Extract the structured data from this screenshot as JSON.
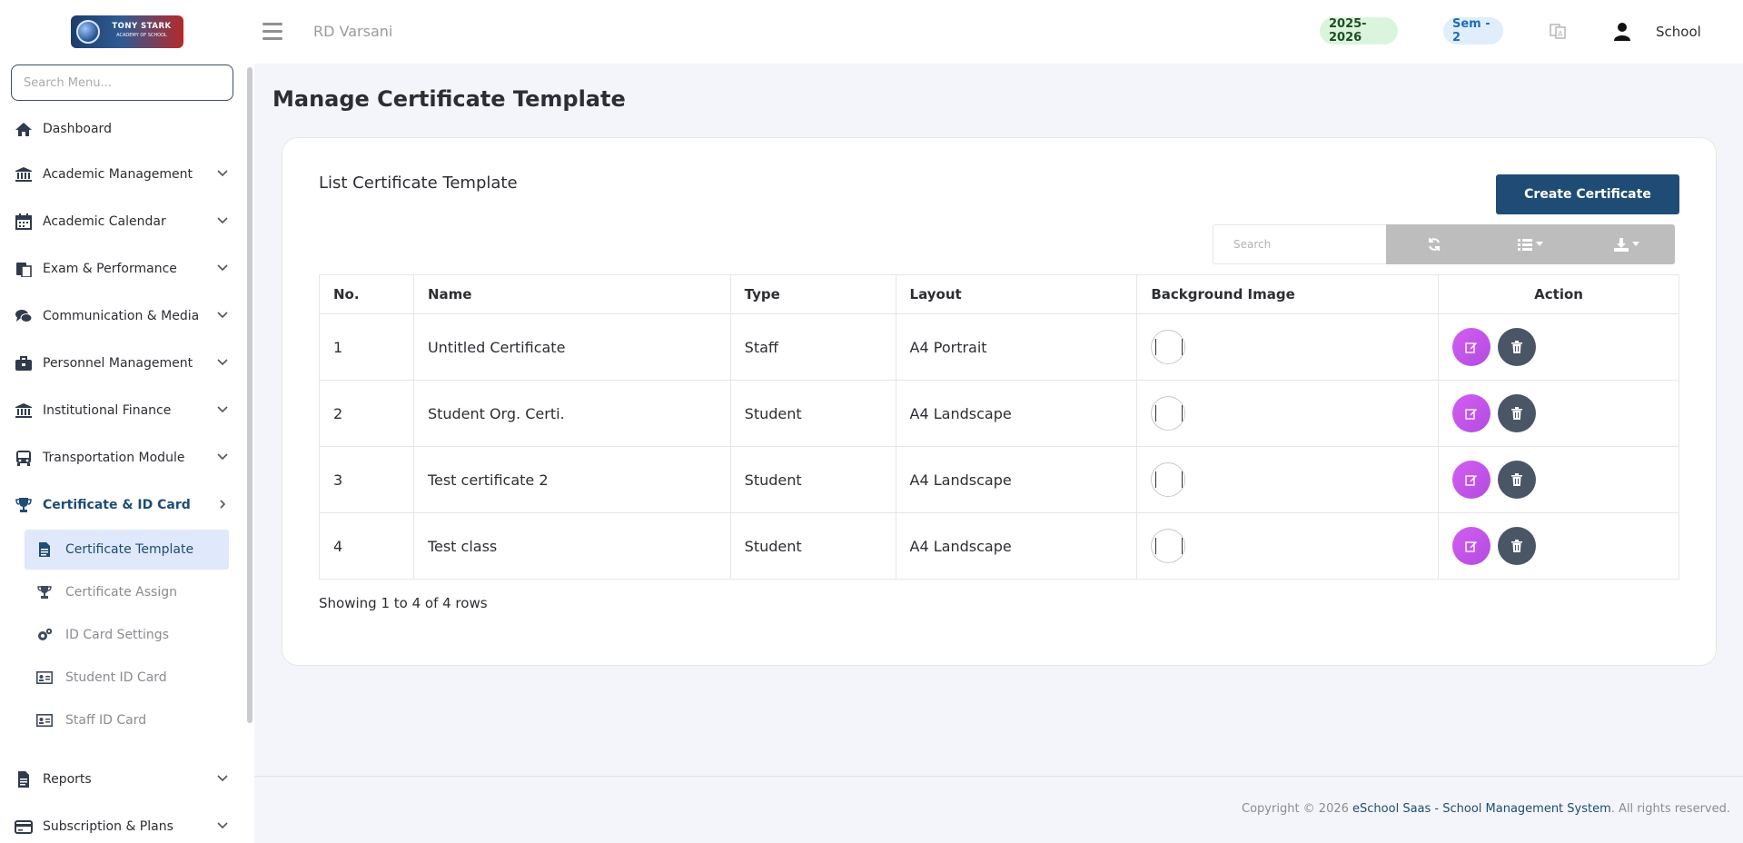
{
  "header": {
    "brand_text": "TONY STARK",
    "brand_subtext": "ACADEMY OF SCHOOL",
    "school_name": "RD Varsani",
    "session_year": "2025-2026",
    "semester": "Sem - 2",
    "user_label": "School"
  },
  "sidebar": {
    "search_placeholder": "Search Menu...",
    "items": [
      {
        "label": "Dashboard",
        "icon": "home-icon"
      },
      {
        "label": "Academic Management",
        "icon": "bank-icon"
      },
      {
        "label": "Academic Calendar",
        "icon": "calendar-icon"
      },
      {
        "label": "Exam & Performance",
        "icon": "paste-icon"
      },
      {
        "label": "Communication & Media",
        "icon": "comments-icon"
      },
      {
        "label": "Personnel Management",
        "icon": "briefcase-icon"
      },
      {
        "label": "Institutional Finance",
        "icon": "bank-icon"
      },
      {
        "label": "Transportation Module",
        "icon": "bus-icon"
      },
      {
        "label": "Certificate & ID Card",
        "icon": "trophy-icon"
      },
      {
        "label": "Reports",
        "icon": "file-icon"
      },
      {
        "label": "Subscription & Plans",
        "icon": "credit-card-icon"
      }
    ],
    "sub_items": [
      {
        "label": "Certificate Template",
        "icon": "file-text-icon"
      },
      {
        "label": "Certificate Assign",
        "icon": "trophy-icon"
      },
      {
        "label": "ID Card Settings",
        "icon": "cogs-icon"
      },
      {
        "label": "Student ID Card",
        "icon": "id-card-icon"
      },
      {
        "label": "Staff ID Card",
        "icon": "id-card-icon"
      }
    ]
  },
  "main": {
    "page_title": "Manage Certificate Template",
    "card_title": "List Certificate Template",
    "create_button": "Create Certificate",
    "table_search_placeholder": "Search",
    "columns": [
      "No.",
      "Name",
      "Type",
      "Layout",
      "Background Image",
      "Action"
    ],
    "rows": [
      {
        "no": "1",
        "name": "Untitled Certificate",
        "type": "Staff",
        "layout": "A4 Portrait"
      },
      {
        "no": "2",
        "name": "Student Org. Certi.",
        "type": "Student",
        "layout": "A4 Landscape"
      },
      {
        "no": "3",
        "name": "Test certificate 2",
        "type": "Student",
        "layout": "A4 Landscape"
      },
      {
        "no": "4",
        "name": "Test class",
        "type": "Student",
        "layout": "A4 Landscape"
      }
    ],
    "rows_info": "Showing 1 to 4 of 4 rows"
  },
  "footer": {
    "prefix": "Copyright © 2026 ",
    "link_text": "eSchool Saas - School Management System",
    "suffix": ". All rights reserved."
  },
  "colors": {
    "primary": "#1f4c74",
    "edit_button": "#c957ec",
    "delete_button": "#4a5565",
    "active_sub_bg": "#dfe9fb",
    "year_pill_bg": "#dbf5dc",
    "sem_pill_bg": "#e0eefc"
  }
}
